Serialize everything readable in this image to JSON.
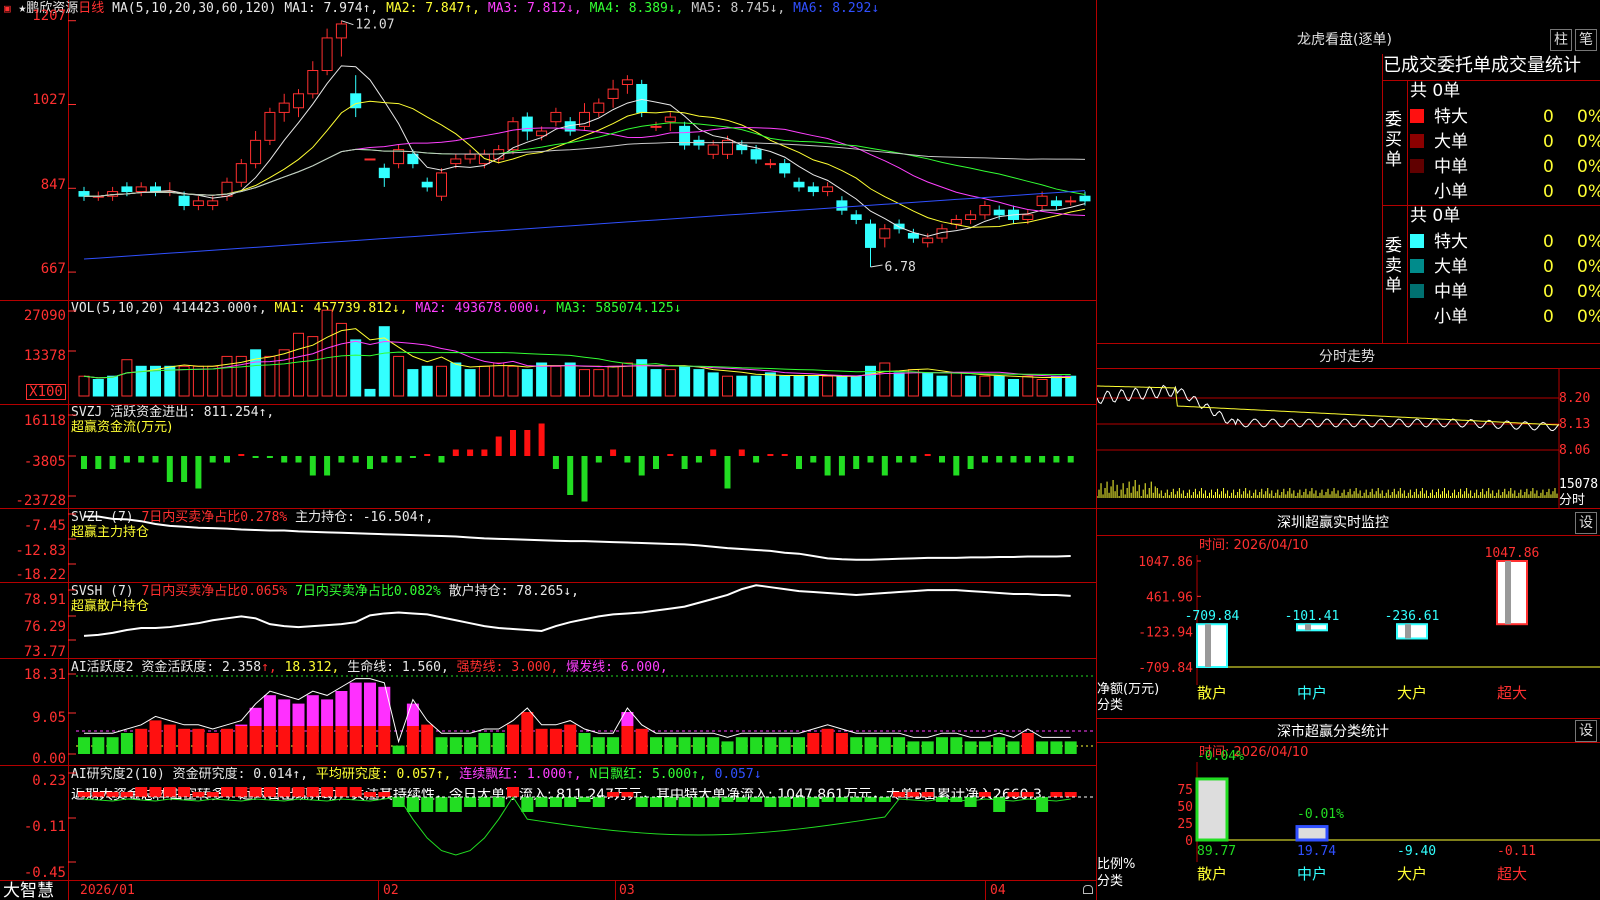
{
  "colors": {
    "up": "#ff3030",
    "down": "#33ffff",
    "grid": "#b40000",
    "ma1": "#e8e8e8",
    "ma2": "#ffff33",
    "ma3": "#ff40ff",
    "ma4": "#33ff33",
    "ma5": "#c8c8c8",
    "ma6": "#3050ff"
  },
  "header": {
    "star": "★",
    "stock_name": "鹏欣资源",
    "period": "日线",
    "ma_params": "MA(5,10,20,30,60,120)",
    "ma1": "MA1: 7.974↑,",
    "ma2": "MA2: 7.847↑,",
    "ma3": "MA3: 7.812↓,",
    "ma4": "MA4: 8.389↓,",
    "ma5": "MA5: 8.745↓,",
    "ma6": "MA6: 8.292↓"
  },
  "kline": {
    "y_labels": [
      "1207",
      "1027",
      "847",
      "667"
    ],
    "high_label": "12.07",
    "low_label": "6.78",
    "candles": [
      {
        "o": 8.4,
        "c": 8.3,
        "h": 8.5,
        "l": 8.2
      },
      {
        "o": 8.3,
        "c": 8.3,
        "h": 8.4,
        "l": 8.2
      },
      {
        "o": 8.3,
        "c": 8.4,
        "h": 8.5,
        "l": 8.2
      },
      {
        "o": 8.5,
        "c": 8.4,
        "h": 8.6,
        "l": 8.3
      },
      {
        "o": 8.4,
        "c": 8.5,
        "h": 8.6,
        "l": 8.3
      },
      {
        "o": 8.5,
        "c": 8.4,
        "h": 8.6,
        "l": 8.3
      },
      {
        "o": 8.4,
        "c": 8.4,
        "h": 8.6,
        "l": 8.3
      },
      {
        "o": 8.3,
        "c": 8.1,
        "h": 8.4,
        "l": 8.0
      },
      {
        "o": 8.1,
        "c": 8.2,
        "h": 8.3,
        "l": 8.0
      },
      {
        "o": 8.1,
        "c": 8.2,
        "h": 8.3,
        "l": 8.0
      },
      {
        "o": 8.3,
        "c": 8.6,
        "h": 8.7,
        "l": 8.2
      },
      {
        "o": 8.6,
        "c": 9.0,
        "h": 9.1,
        "l": 8.5
      },
      {
        "o": 9.0,
        "c": 9.5,
        "h": 9.7,
        "l": 8.9
      },
      {
        "o": 9.5,
        "c": 10.1,
        "h": 10.2,
        "l": 9.4
      },
      {
        "o": 10.1,
        "c": 10.3,
        "h": 10.5,
        "l": 9.9
      },
      {
        "o": 10.2,
        "c": 10.5,
        "h": 10.6,
        "l": 10.0
      },
      {
        "o": 10.5,
        "c": 11.0,
        "h": 11.2,
        "l": 10.4
      },
      {
        "o": 11.0,
        "c": 11.7,
        "h": 11.9,
        "l": 10.9
      },
      {
        "o": 11.7,
        "c": 12.0,
        "h": 12.07,
        "l": 11.3
      },
      {
        "o": 10.5,
        "c": 10.2,
        "h": 10.9,
        "l": 10.0
      },
      {
        "o": 9.1,
        "c": 9.1,
        "h": 9.1,
        "l": 9.1
      },
      {
        "o": 8.9,
        "c": 8.7,
        "h": 9.0,
        "l": 8.5
      },
      {
        "o": 9.0,
        "c": 9.3,
        "h": 9.4,
        "l": 8.9
      },
      {
        "o": 9.2,
        "c": 9.0,
        "h": 9.3,
        "l": 8.9
      },
      {
        "o": 8.6,
        "c": 8.5,
        "h": 8.7,
        "l": 8.4
      },
      {
        "o": 8.3,
        "c": 8.8,
        "h": 8.9,
        "l": 8.2
      },
      {
        "o": 9.0,
        "c": 9.1,
        "h": 9.2,
        "l": 8.9
      },
      {
        "o": 9.1,
        "c": 9.2,
        "h": 9.3,
        "l": 9.0
      },
      {
        "o": 9.0,
        "c": 9.2,
        "h": 9.3,
        "l": 8.9
      },
      {
        "o": 9.1,
        "c": 9.3,
        "h": 9.4,
        "l": 9.0
      },
      {
        "o": 9.3,
        "c": 9.9,
        "h": 10.0,
        "l": 9.2
      },
      {
        "o": 10.0,
        "c": 9.7,
        "h": 10.1,
        "l": 9.5
      },
      {
        "o": 9.6,
        "c": 9.7,
        "h": 9.8,
        "l": 9.5
      },
      {
        "o": 9.9,
        "c": 10.1,
        "h": 10.2,
        "l": 9.8
      },
      {
        "o": 9.9,
        "c": 9.7,
        "h": 10.0,
        "l": 9.6
      },
      {
        "o": 9.8,
        "c": 10.1,
        "h": 10.3,
        "l": 9.7
      },
      {
        "o": 10.1,
        "c": 10.3,
        "h": 10.4,
        "l": 10.0
      },
      {
        "o": 10.4,
        "c": 10.6,
        "h": 10.8,
        "l": 10.2
      },
      {
        "o": 10.7,
        "c": 10.8,
        "h": 10.9,
        "l": 10.5
      },
      {
        "o": 10.7,
        "c": 10.1,
        "h": 10.8,
        "l": 10.0
      },
      {
        "o": 9.8,
        "c": 9.8,
        "h": 9.9,
        "l": 9.7
      },
      {
        "o": 9.9,
        "c": 10.0,
        "h": 10.1,
        "l": 9.7
      },
      {
        "o": 9.8,
        "c": 9.4,
        "h": 9.9,
        "l": 9.3
      },
      {
        "o": 9.5,
        "c": 9.4,
        "h": 9.6,
        "l": 9.3
      },
      {
        "o": 9.2,
        "c": 9.4,
        "h": 9.5,
        "l": 9.1
      },
      {
        "o": 9.2,
        "c": 9.5,
        "h": 9.6,
        "l": 9.1
      },
      {
        "o": 9.4,
        "c": 9.3,
        "h": 9.5,
        "l": 9.2
      },
      {
        "o": 9.3,
        "c": 9.1,
        "h": 9.4,
        "l": 9.0
      },
      {
        "o": 9.0,
        "c": 9.0,
        "h": 9.1,
        "l": 8.9
      },
      {
        "o": 9.0,
        "c": 8.8,
        "h": 9.1,
        "l": 8.7
      },
      {
        "o": 8.6,
        "c": 8.5,
        "h": 8.7,
        "l": 8.4
      },
      {
        "o": 8.5,
        "c": 8.4,
        "h": 8.6,
        "l": 8.3
      },
      {
        "o": 8.4,
        "c": 8.5,
        "h": 8.6,
        "l": 8.3
      },
      {
        "o": 8.2,
        "c": 8.0,
        "h": 8.3,
        "l": 7.9
      },
      {
        "o": 7.9,
        "c": 7.8,
        "h": 8.0,
        "l": 7.7
      },
      {
        "o": 7.7,
        "c": 7.2,
        "h": 7.8,
        "l": 6.78
      },
      {
        "o": 7.4,
        "c": 7.6,
        "h": 7.7,
        "l": 7.2
      },
      {
        "o": 7.7,
        "c": 7.6,
        "h": 7.8,
        "l": 7.5
      },
      {
        "o": 7.5,
        "c": 7.4,
        "h": 7.6,
        "l": 7.3
      },
      {
        "o": 7.3,
        "c": 7.4,
        "h": 7.5,
        "l": 7.2
      },
      {
        "o": 7.4,
        "c": 7.6,
        "h": 7.7,
        "l": 7.3
      },
      {
        "o": 7.7,
        "c": 7.8,
        "h": 7.9,
        "l": 7.6
      },
      {
        "o": 7.8,
        "c": 7.9,
        "h": 8.0,
        "l": 7.7
      },
      {
        "o": 7.9,
        "c": 8.1,
        "h": 8.2,
        "l": 7.8
      },
      {
        "o": 8.0,
        "c": 7.9,
        "h": 8.1,
        "l": 7.8
      },
      {
        "o": 8.0,
        "c": 7.8,
        "h": 8.1,
        "l": 7.7
      },
      {
        "o": 7.8,
        "c": 7.9,
        "h": 8.0,
        "l": 7.7
      },
      {
        "o": 8.1,
        "c": 8.3,
        "h": 8.4,
        "l": 8.0
      },
      {
        "o": 8.2,
        "c": 8.1,
        "h": 8.3,
        "l": 8.0
      },
      {
        "o": 8.2,
        "c": 8.2,
        "h": 8.3,
        "l": 8.1
      },
      {
        "o": 8.3,
        "c": 8.2,
        "h": 8.4,
        "l": 8.1
      }
    ]
  },
  "vol": {
    "title": "VOL(5,10,20)",
    "value": "414423.000↑,",
    "ma1": "MA1: 457739.812↓,",
    "ma2": "MA2: 493678.000↓,",
    "ma3": "MA3: 585074.125↓",
    "y_labels": [
      "27090",
      "13378",
      "X100"
    ],
    "bars": [
      6,
      5,
      6,
      11,
      9,
      9,
      9,
      9,
      9,
      9,
      12,
      12,
      14,
      12,
      14,
      19,
      18,
      26,
      22,
      17,
      2,
      21,
      12,
      8,
      9,
      9,
      10,
      8,
      9,
      10,
      9,
      8,
      10,
      9,
      10,
      8,
      8,
      9,
      10,
      11,
      8,
      8,
      9,
      8,
      7,
      6,
      6,
      6,
      7,
      6,
      6,
      6,
      6,
      6,
      6,
      9,
      10,
      7,
      8,
      7,
      6,
      7,
      6,
      6,
      6,
      5,
      6,
      5,
      6,
      6
    ],
    "colors": [
      "u",
      "d",
      "d",
      "u",
      "d",
      "d",
      "d",
      "u",
      "u",
      "u",
      "u",
      "u",
      "d",
      "u",
      "u",
      "u",
      "u",
      "u",
      "u",
      "d",
      "d",
      "d",
      "u",
      "d",
      "d",
      "u",
      "d",
      "d",
      "u",
      "u",
      "u",
      "d",
      "d",
      "u",
      "d",
      "u",
      "u",
      "u",
      "u",
      "d",
      "d",
      "u",
      "d",
      "d",
      "d",
      "u",
      "d",
      "d",
      "d",
      "d",
      "d",
      "d",
      "u",
      "d",
      "d",
      "d",
      "u",
      "d",
      "u",
      "d",
      "d",
      "u",
      "d",
      "u",
      "d",
      "d",
      "u",
      "u",
      "d",
      "d"
    ]
  },
  "svzj": {
    "title": "SVZJ",
    "text": "活跃资金进出: 811.254↑,",
    "sub": "超赢资金流(万元)",
    "y_labels": [
      "16118",
      "-3805",
      "-23728"
    ],
    "values": [
      -2,
      -2,
      -2,
      -1,
      -1,
      -1,
      -4,
      -4,
      -5,
      -1,
      -1,
      0,
      0,
      0,
      -1,
      -1,
      -3,
      -3,
      -1,
      -1,
      -2,
      -1,
      -1,
      0,
      0,
      -1,
      1,
      1,
      1,
      3,
      4,
      4,
      5,
      -2,
      -6,
      -7,
      -1,
      1,
      -1,
      -3,
      -2,
      0,
      -2,
      -1,
      1,
      -5,
      1,
      -1,
      0,
      0,
      -2,
      -1,
      -3,
      -3,
      -2,
      -1,
      -3,
      -1,
      -1,
      0,
      -1,
      -3,
      -2,
      -1,
      -1,
      -1,
      -1,
      -1,
      -1,
      -1
    ],
    "colorset": [
      "g",
      "g",
      "g",
      "g",
      "g",
      "g",
      "g",
      "g",
      "g",
      "g",
      "g",
      "r",
      "g",
      "g",
      "g",
      "g",
      "g",
      "g",
      "g",
      "g",
      "g",
      "g",
      "g",
      "g",
      "r",
      "g",
      "r",
      "r",
      "r",
      "r",
      "r",
      "r",
      "r",
      "g",
      "g",
      "g",
      "g",
      "r",
      "g",
      "g",
      "g",
      "r",
      "g",
      "g",
      "r",
      "g",
      "r",
      "g",
      "r",
      "r",
      "g",
      "g",
      "g",
      "g",
      "g",
      "g",
      "g",
      "g",
      "g",
      "r",
      "g",
      "g",
      "g",
      "g",
      "g",
      "g",
      "g",
      "g",
      "g",
      "g"
    ]
  },
  "svzl": {
    "title": "SVZL  (7)",
    "net": "7日内买卖净占比0.278%",
    "pos": "主力持仓: -16.504↑,",
    "sub": "超赢主力持仓",
    "y_labels": [
      "-7.45",
      "-12.83",
      "-18.22"
    ],
    "values": [
      -8,
      -8,
      -8.5,
      -8.6,
      -9,
      -9.6,
      -10,
      -10.2,
      -10.4,
      -10.5,
      -10.6,
      -10.8,
      -10.9,
      -11,
      -11,
      -11.2,
      -11.3,
      -11.4,
      -11.5,
      -11.6,
      -11.7,
      -11.8,
      -11.9,
      -12,
      -12.1,
      -12.2,
      -12.3,
      -12.5,
      -12.7,
      -12.8,
      -12.9,
      -13,
      -13.1,
      -13.2,
      -13.3,
      -13.3,
      -13.4,
      -13.5,
      -13.6,
      -13.7,
      -13.8,
      -13.9,
      -14,
      -14.2,
      -14.5,
      -14.8,
      -15,
      -15.2,
      -15.4,
      -15.8,
      -16,
      -16.5,
      -17,
      -17.2,
      -17.3,
      -17.3,
      -17.2,
      -17.1,
      -17.0,
      -16.9,
      -16.9,
      -16.9,
      -16.8,
      -16.8,
      -16.7,
      -16.7,
      -16.6,
      -16.6,
      -16.6,
      -16.5
    ]
  },
  "svsh": {
    "title": "SVSH  (7)",
    "a": "7日内买卖净占比0.065%",
    "b": "7日内买卖净占比0.082%",
    "pos": "散户持仓: 78.265↓,",
    "sub": "超赢散户持仓",
    "y_labels": [
      "78.91",
      "76.29",
      "73.77"
    ],
    "values": [
      74.2,
      74.3,
      74.5,
      74.8,
      75,
      75,
      75.1,
      75.3,
      75.5,
      75.8,
      76,
      76.2,
      76,
      75.4,
      75.2,
      75.1,
      75.2,
      75.3,
      75.4,
      75.6,
      76.3,
      76.5,
      76.6,
      76.5,
      76.4,
      76.1,
      75.8,
      75.5,
      75.2,
      75.0,
      74.9,
      74.8,
      74.7,
      75.2,
      75.6,
      75.9,
      76.2,
      76.4,
      76.5,
      76.6,
      76.8,
      77,
      77.2,
      77.6,
      78.0,
      78.4,
      79.0,
      79.4,
      79.2,
      79.0,
      78.8,
      78.7,
      78.6,
      78.5,
      78.4,
      78.5,
      78.6,
      78.7,
      78.8,
      78.9,
      78.9,
      78.9,
      78.8,
      78.7,
      78.6,
      78.5,
      78.5,
      78.4,
      78.4,
      78.3
    ]
  },
  "ai": {
    "title": "AI活跃度2",
    "act": "资金活跃度: 2.358",
    "v2": "18.312,",
    "life": "生命线: 1.560,",
    "strong": "强势线: 3.000,",
    "burst": "爆发线: 6.000,",
    "y_labels": [
      "18.31",
      "9.05",
      "0.00"
    ],
    "bars": [
      4,
      4,
      4,
      5,
      6,
      8,
      7,
      6,
      6,
      5,
      6,
      7,
      11,
      14,
      13,
      12,
      14,
      13,
      15,
      17,
      17,
      16,
      2,
      12,
      7,
      4,
      4,
      4,
      5,
      5,
      7,
      10,
      6,
      6,
      7,
      5,
      4,
      4,
      10,
      6,
      4,
      4,
      4,
      4,
      4,
      3,
      4,
      4,
      4,
      4,
      4,
      5,
      6,
      5,
      4,
      4,
      4,
      4,
      3,
      3,
      4,
      4,
      3,
      3,
      4,
      3,
      5,
      3,
      3,
      3
    ],
    "types": [
      "g",
      "g",
      "g",
      "g",
      "m",
      "r",
      "r",
      "r",
      "r",
      "r",
      "r",
      "m",
      "m",
      "m",
      "m",
      "m",
      "m",
      "m",
      "m",
      "m",
      "m",
      "m",
      "g",
      "m",
      "r",
      "g",
      "g",
      "g",
      "g",
      "g",
      "r",
      "r",
      "r",
      "r",
      "r",
      "g",
      "g",
      "g",
      "m",
      "r",
      "g",
      "g",
      "g",
      "g",
      "g",
      "g",
      "g",
      "g",
      "g",
      "g",
      "g",
      "r",
      "r",
      "r",
      "g",
      "g",
      "g",
      "g",
      "g",
      "g",
      "g",
      "g",
      "g",
      "g",
      "g",
      "g",
      "r",
      "g",
      "g",
      "g"
    ]
  },
  "ai2": {
    "title": "AI研究度2(10)",
    "res": "资金研究度: 0.014↑,",
    "avg": "平均研究度: 0.057↑,",
    "red": "连续飘红: 1.000↑,",
    "nred": "N日飘红: 5.000↑,",
    "last": "0.057↓",
    "y_labels": [
      "0.23",
      "-0.11",
      "-0.45"
    ],
    "commentary": "近期大资金总体由空转多，近两日出现异动，关注其持续性，今日大单净流入: 811.247万元，其中特大单净流入: 1047.861万元，大单5日累计净入2660.3"
  },
  "xaxis": {
    "labels": [
      "2026/01",
      "02",
      "03",
      "04"
    ]
  },
  "footer": {
    "brand": "大智慧"
  },
  "dragon": {
    "title": "龙虎看盘(逐单)",
    "tab1": "柱",
    "tab2": "笔",
    "heading": "已成交委托单成交量统计",
    "buy_label": "委买单",
    "sell_label": "委卖单",
    "buy_total": "共 0单",
    "sell_total": "共 0单",
    "buy_rows": [
      {
        "name": "特大",
        "count": "0",
        "pct": "0%",
        "color": "#ff1010"
      },
      {
        "name": "大单",
        "count": "0",
        "pct": "0%",
        "color": "#8b0000"
      },
      {
        "name": "中单",
        "count": "0",
        "pct": "0%",
        "color": "#600000"
      },
      {
        "name": "小单",
        "count": "0",
        "pct": "0%",
        "color": ""
      }
    ],
    "sell_rows": [
      {
        "name": "特大",
        "count": "0",
        "pct": "0%",
        "color": "#33ffff"
      },
      {
        "name": "大单",
        "count": "0",
        "pct": "0%",
        "color": "#008b8b"
      },
      {
        "name": "中单",
        "count": "0",
        "pct": "0%",
        "color": "#007070"
      },
      {
        "name": "小单",
        "count": "0",
        "pct": "0%",
        "color": ""
      }
    ]
  },
  "intraday": {
    "title": "分时走势",
    "y_labels": [
      "8.20",
      "8.13",
      "8.06"
    ],
    "vol_label": "15078",
    "time_label": "分时"
  },
  "sz_monitor": {
    "title": "深圳超赢实时监控",
    "settings": "设",
    "time": "时间: 2026/04/10",
    "y_labels": [
      "1047.86",
      "461.96",
      "-123.94",
      "-709.84"
    ],
    "y_title": "净额(万元)",
    "x_title": "分类",
    "categories": [
      "散户",
      "中户",
      "大户",
      "超大"
    ],
    "values": [
      -709.84,
      -101.41,
      -236.61,
      1047.86
    ],
    "value_labels": [
      "-709.84",
      "-101.41",
      "-236.61",
      "1047.86"
    ]
  },
  "sz_class": {
    "title": "深市超赢分类统计",
    "settings": "设",
    "time": "时间: 2026/04/10",
    "y_labels": [
      "75",
      "50",
      "25",
      "0"
    ],
    "y_title": "比例%",
    "x_title": "分类",
    "categories": [
      "散户",
      "中户",
      "大户",
      "超大"
    ],
    "bar_values": [
      89.77,
      19.74,
      0,
      0
    ],
    "top_labels": [
      "-0.04%",
      "-0.01%"
    ],
    "bottom_labels": [
      "89.77",
      "19.74",
      "-9.40",
      "-0.11"
    ]
  }
}
